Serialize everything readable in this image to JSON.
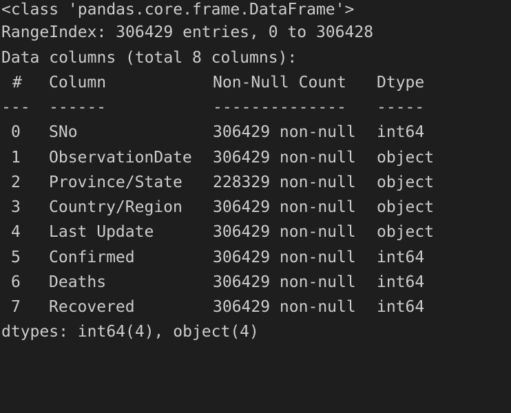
{
  "output": {
    "class_line": "<class 'pandas.core.frame.DataFrame'>",
    "range_index": "RangeIndex: 306429 entries, 0 to 306428",
    "columns_summary": "Data columns (total 8 columns):",
    "headers": {
      "index": "#",
      "column": "Column",
      "non_null": "Non-Null Count",
      "dtype": "Dtype"
    },
    "separators": {
      "index": "---",
      "column": "------",
      "non_null": "--------------",
      "dtype": "-----"
    },
    "rows": [
      {
        "index": "0",
        "column": "SNo",
        "non_null": "306429 non-null",
        "dtype": "int64"
      },
      {
        "index": "1",
        "column": "ObservationDate",
        "non_null": "306429 non-null",
        "dtype": "object"
      },
      {
        "index": "2",
        "column": "Province/State",
        "non_null": "228329 non-null",
        "dtype": "object"
      },
      {
        "index": "3",
        "column": "Country/Region",
        "non_null": "306429 non-null",
        "dtype": "object"
      },
      {
        "index": "4",
        "column": "Last Update",
        "non_null": "306429 non-null",
        "dtype": "object"
      },
      {
        "index": "5",
        "column": "Confirmed",
        "non_null": "306429 non-null",
        "dtype": "int64"
      },
      {
        "index": "6",
        "column": "Deaths",
        "non_null": "306429 non-null",
        "dtype": "int64"
      },
      {
        "index": "7",
        "column": "Recovered",
        "non_null": "306429 non-null",
        "dtype": "int64"
      }
    ],
    "dtypes_line": "dtypes: int64(4), object(4)"
  },
  "colors": {
    "background": "#1e1e1e",
    "text": "#cccccc"
  }
}
